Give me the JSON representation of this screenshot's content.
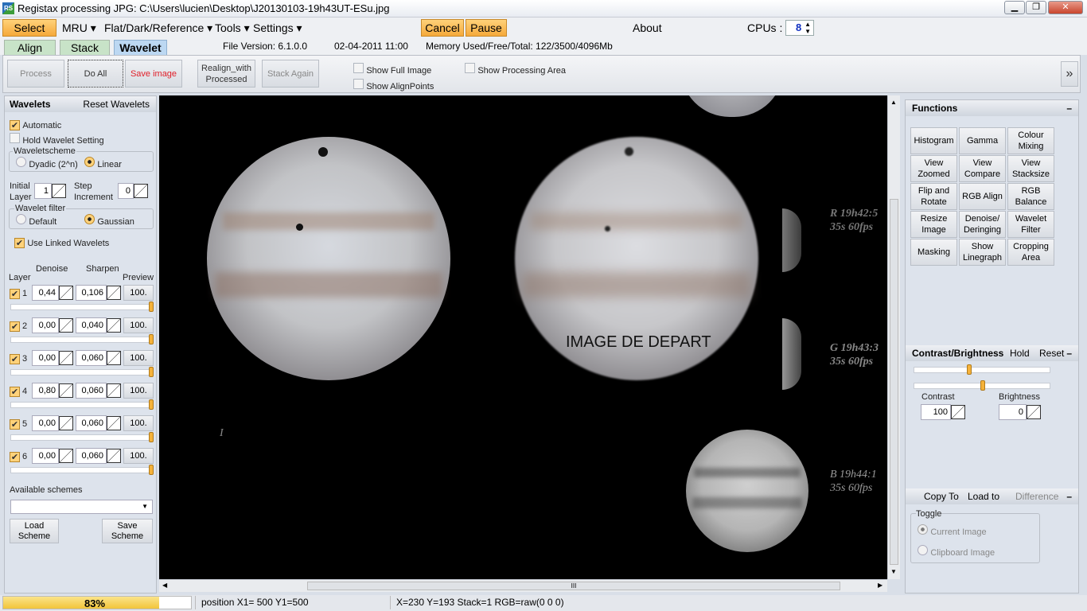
{
  "window": {
    "title": "Registax processing JPG: C:\\Users\\lucien\\Desktop\\J20130103-19h43UT-ESu.jpg",
    "icon": "RS",
    "minimize": "▁",
    "maximize": "❐",
    "close": "✕"
  },
  "menu": {
    "select": "Select",
    "mru": "MRU ▾",
    "flat": "Flat/Dark/Reference ▾",
    "tools": "Tools ▾",
    "settings": "Settings ▾",
    "cancel": "Cancel",
    "pause": "Pause",
    "about": "About",
    "cpus_label": "CPUs :",
    "cpus_value": "8"
  },
  "tabs": {
    "align": "Align",
    "stack": "Stack",
    "wavelet": "Wavelet"
  },
  "info": {
    "file_version": "File Version: 6.1.0.0",
    "date": "02-04-2011 11:00",
    "memory": "Memory Used/Free/Total: 122/3500/4096Mb"
  },
  "toolbar": {
    "process": "Process",
    "do_all": "Do All",
    "save_image": "Save image",
    "realign": "Realign_with Processed",
    "stack_again": "Stack Again",
    "show_full_image": "Show Full Image",
    "show_alignpoints": "Show AlignPoints",
    "show_processing_area": "Show Processing Area",
    "expand": "»"
  },
  "wavelets": {
    "title": "Wavelets",
    "reset": "Reset Wavelets",
    "automatic": "Automatic",
    "hold": "Hold Wavelet Setting",
    "scheme_label": "Waveletscheme",
    "dyadic": "Dyadic (2^n)",
    "linear": "Linear",
    "initial_layer_label1": "Initial",
    "initial_layer_label2": "Layer",
    "initial_layer": "1",
    "step_label1": "Step",
    "step_label2": "Increment",
    "step": "0",
    "filter_label": "Wavelet filter",
    "default": "Default",
    "gaussian": "Gaussian",
    "linked": "Use Linked Wavelets",
    "col_denoise": "Denoise",
    "col_sharpen": "Sharpen",
    "col_layer": "Layer",
    "col_preview": "Preview",
    "layers": [
      {
        "n": "1",
        "denoise": "0,44",
        "sharpen": "0,106",
        "preview": "100."
      },
      {
        "n": "2",
        "denoise": "0,00",
        "sharpen": "0,040",
        "preview": "100."
      },
      {
        "n": "3",
        "denoise": "0,00",
        "sharpen": "0,060",
        "preview": "100."
      },
      {
        "n": "4",
        "denoise": "0,80",
        "sharpen": "0,060",
        "preview": "100."
      },
      {
        "n": "5",
        "denoise": "0,00",
        "sharpen": "0,060",
        "preview": "100."
      },
      {
        "n": "6",
        "denoise": "0,00",
        "sharpen": "0,060",
        "preview": "100."
      }
    ],
    "available_schemes": "Available schemes",
    "load_scheme": "Load Scheme",
    "save_scheme": "Save Scheme"
  },
  "image": {
    "caption": "IMAGE DE DEPART",
    "r_label": "R 19h42:5",
    "r_sub": "35s 60fps",
    "g_label": "G 19h43:3",
    "g_sub": "35s 60fps",
    "b_label": "B 19h44:1",
    "b_sub": "35s 60fps",
    "marker": "I"
  },
  "functions": {
    "title": "Functions",
    "collapse": "–",
    "buttons": [
      "Histogram",
      "Gamma",
      "Colour Mixing",
      "View Zoomed",
      "View Compare",
      "View Stacksize",
      "Flip and Rotate",
      "RGB Align",
      "RGB Balance",
      "Resize Image",
      "Denoise/ Deringing",
      "Wavelet Filter",
      "Masking",
      "Show Linegraph",
      "Cropping Area"
    ]
  },
  "contrast": {
    "title": "Contrast/Brightness",
    "hold": "Hold",
    "reset": "Reset",
    "collapse": "–",
    "contrast_label": "Contrast",
    "contrast": "100",
    "brightness_label": "Brightness",
    "brightness": "0",
    "slider1": 0.4,
    "slider2": 0.5
  },
  "copy": {
    "copy_to": "Copy To",
    "load_to": "Load to",
    "difference": "Difference",
    "collapse": "–",
    "toggle": "Toggle",
    "current": "Current Image",
    "clipboard": "Clipboard Image"
  },
  "status": {
    "progress": "83%",
    "progress_value": 0.83,
    "position": "position X1= 500 Y1=500",
    "coords": "X=230 Y=193 Stack=1 RGB=raw(0 0 0)"
  }
}
